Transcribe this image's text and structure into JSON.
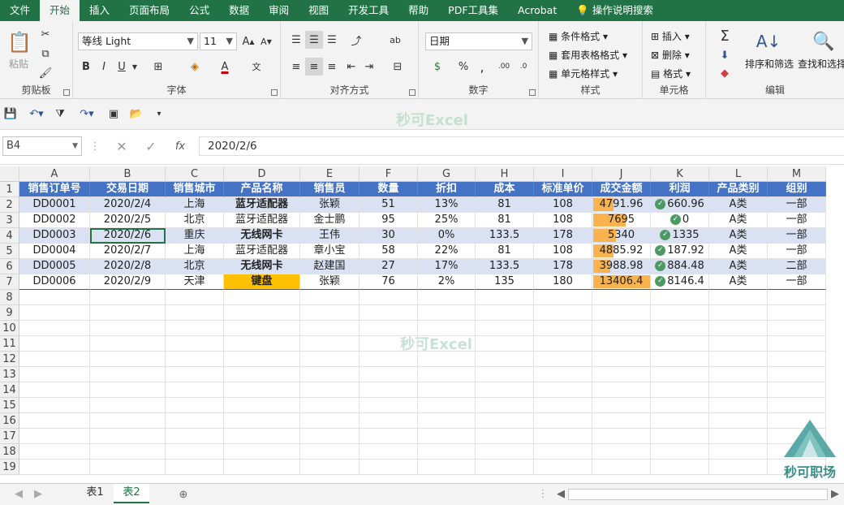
{
  "ribbon_tabs": [
    "文件",
    "开始",
    "插入",
    "页面布局",
    "公式",
    "数据",
    "审阅",
    "视图",
    "开发工具",
    "帮助",
    "PDF工具集",
    "Acrobat",
    "操作说明搜索"
  ],
  "active_tab": "开始",
  "clipboard": {
    "paste": "粘贴",
    "label": "剪贴板"
  },
  "font": {
    "name": "等线 Light",
    "size": "11",
    "label": "字体",
    "bold": "B",
    "italic": "I",
    "underline": "U"
  },
  "alignment": {
    "label": "对齐方式"
  },
  "number": {
    "format": "日期",
    "label": "数字"
  },
  "styles": {
    "conditional": "条件格式",
    "table": "套用表格格式",
    "cell": "单元格样式",
    "label": "样式"
  },
  "cells": {
    "insert": "插入",
    "delete": "删除",
    "format": "格式",
    "label": "单元格"
  },
  "editing": {
    "sort": "排序和筛选",
    "find": "查找和选择",
    "label": "编辑"
  },
  "watermark": "秒可Excel",
  "namebox": "B4",
  "formula": "2020/2/6",
  "columns": [
    "A",
    "B",
    "C",
    "D",
    "E",
    "F",
    "G",
    "H",
    "I",
    "J",
    "K",
    "L",
    "M"
  ],
  "row_numbers": [
    "1",
    "2",
    "3",
    "4",
    "5",
    "6",
    "7",
    "8",
    "9",
    "10",
    "11",
    "12",
    "13",
    "14",
    "15",
    "16",
    "17",
    "18",
    "19"
  ],
  "headers": [
    "销售订单号",
    "交易日期",
    "销售城市",
    "产品名称",
    "销售员",
    "数量",
    "折扣",
    "成本",
    "标准单价",
    "成交金额",
    "利润",
    "产品类别",
    "组别"
  ],
  "rows": [
    {
      "a": "DD0001",
      "b": "2020/2/4",
      "c": "上海",
      "d": "蓝牙适配器",
      "e": "张颖",
      "f": "51",
      "g": "13%",
      "h": "81",
      "i": "108",
      "j": "4791.96",
      "jfrac": 0.36,
      "k": "660.96",
      "l": "A类",
      "m": "一部",
      "dstyle": "bold"
    },
    {
      "a": "DD0002",
      "b": "2020/2/5",
      "c": "北京",
      "d": "蓝牙适配器",
      "e": "金士鹏",
      "f": "95",
      "g": "25%",
      "h": "81",
      "i": "108",
      "j": "7695",
      "jfrac": 0.57,
      "k": "0",
      "l": "A类",
      "m": "一部",
      "dstyle": ""
    },
    {
      "a": "DD0003",
      "b": "2020/2/6",
      "c": "重庆",
      "d": "无线网卡",
      "e": "王伟",
      "f": "30",
      "g": "0%",
      "h": "133.5",
      "i": "178",
      "j": "5340",
      "jfrac": 0.4,
      "k": "1335",
      "l": "A类",
      "m": "一部",
      "dstyle": "bold"
    },
    {
      "a": "DD0004",
      "b": "2020/2/7",
      "c": "上海",
      "d": "蓝牙适配器",
      "e": "章小宝",
      "f": "58",
      "g": "22%",
      "h": "81",
      "i": "108",
      "j": "4885.92",
      "jfrac": 0.36,
      "k": "187.92",
      "l": "A类",
      "m": "一部",
      "dstyle": ""
    },
    {
      "a": "DD0005",
      "b": "2020/2/8",
      "c": "北京",
      "d": "无线网卡",
      "e": "赵建国",
      "f": "27",
      "g": "17%",
      "h": "133.5",
      "i": "178",
      "j": "3988.98",
      "jfrac": 0.3,
      "k": "884.48",
      "l": "A类",
      "m": "二部",
      "dstyle": "bold"
    },
    {
      "a": "DD0006",
      "b": "2020/2/9",
      "c": "天津",
      "d": "键盘",
      "e": "张颖",
      "f": "76",
      "g": "2%",
      "h": "135",
      "i": "180",
      "j": "13406.4",
      "jfrac": 1.0,
      "k": "8146.4",
      "l": "A类",
      "m": "一部",
      "dstyle": "hl"
    }
  ],
  "sheets": [
    "表1",
    "表2"
  ],
  "active_sheet": "表2",
  "brand": "秒可职场",
  "colors": {
    "excel_green": "#217346",
    "header_blue": "#4472c4",
    "band": "#d9e1f2",
    "highlight": "#ffc000",
    "databar": "#f8b24e"
  }
}
